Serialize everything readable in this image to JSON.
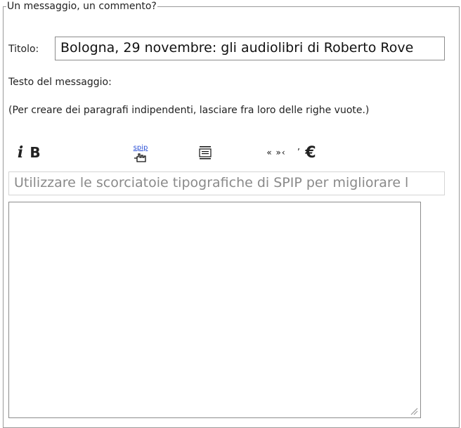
{
  "form": {
    "legend": "Un messaggio, un commento?",
    "title_label": "Titolo:",
    "title_value": "Bologna, 29 novembre: gli audiolibri di Roberto Rove",
    "text_label": "Testo del messaggio:",
    "hint": "(Per creare dei paragrafi indipendenti, lasciare fra loro delle righe vuote.)",
    "help_bar": "Utilizzare le scorciatoie tipografiche di SPIP per migliorare l"
  },
  "toolbar": {
    "italic": "i",
    "bold": "B",
    "link_label": "spip",
    "quotes": "« »‹",
    "apostrophe": "’",
    "euro": "€"
  },
  "icons": [
    "italic-icon",
    "bold-icon",
    "link-icon",
    "paragraph-icon",
    "quotes-icon",
    "apostrophe-icon",
    "euro-icon",
    "resize-icon"
  ]
}
